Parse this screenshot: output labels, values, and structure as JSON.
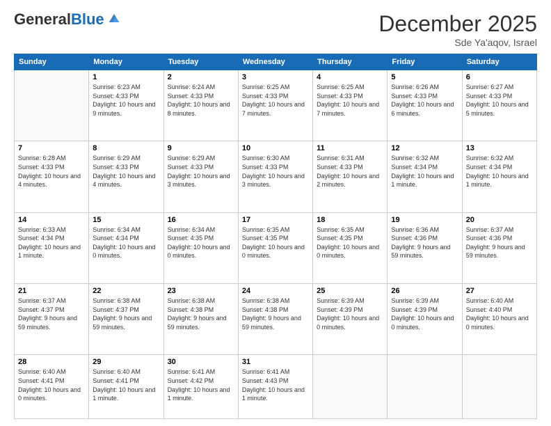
{
  "header": {
    "logo_general": "General",
    "logo_blue": "Blue",
    "month_title": "December 2025",
    "location": "Sde Ya'aqov, Israel"
  },
  "weekdays": [
    "Sunday",
    "Monday",
    "Tuesday",
    "Wednesday",
    "Thursday",
    "Friday",
    "Saturday"
  ],
  "weeks": [
    [
      {
        "day": "",
        "sunrise": "",
        "sunset": "",
        "daylight": ""
      },
      {
        "day": "1",
        "sunrise": "Sunrise: 6:23 AM",
        "sunset": "Sunset: 4:33 PM",
        "daylight": "Daylight: 10 hours and 9 minutes."
      },
      {
        "day": "2",
        "sunrise": "Sunrise: 6:24 AM",
        "sunset": "Sunset: 4:33 PM",
        "daylight": "Daylight: 10 hours and 8 minutes."
      },
      {
        "day": "3",
        "sunrise": "Sunrise: 6:25 AM",
        "sunset": "Sunset: 4:33 PM",
        "daylight": "Daylight: 10 hours and 7 minutes."
      },
      {
        "day": "4",
        "sunrise": "Sunrise: 6:25 AM",
        "sunset": "Sunset: 4:33 PM",
        "daylight": "Daylight: 10 hours and 7 minutes."
      },
      {
        "day": "5",
        "sunrise": "Sunrise: 6:26 AM",
        "sunset": "Sunset: 4:33 PM",
        "daylight": "Daylight: 10 hours and 6 minutes."
      },
      {
        "day": "6",
        "sunrise": "Sunrise: 6:27 AM",
        "sunset": "Sunset: 4:33 PM",
        "daylight": "Daylight: 10 hours and 5 minutes."
      }
    ],
    [
      {
        "day": "7",
        "sunrise": "Sunrise: 6:28 AM",
        "sunset": "Sunset: 4:33 PM",
        "daylight": "Daylight: 10 hours and 4 minutes."
      },
      {
        "day": "8",
        "sunrise": "Sunrise: 6:29 AM",
        "sunset": "Sunset: 4:33 PM",
        "daylight": "Daylight: 10 hours and 4 minutes."
      },
      {
        "day": "9",
        "sunrise": "Sunrise: 6:29 AM",
        "sunset": "Sunset: 4:33 PM",
        "daylight": "Daylight: 10 hours and 3 minutes."
      },
      {
        "day": "10",
        "sunrise": "Sunrise: 6:30 AM",
        "sunset": "Sunset: 4:33 PM",
        "daylight": "Daylight: 10 hours and 3 minutes."
      },
      {
        "day": "11",
        "sunrise": "Sunrise: 6:31 AM",
        "sunset": "Sunset: 4:33 PM",
        "daylight": "Daylight: 10 hours and 2 minutes."
      },
      {
        "day": "12",
        "sunrise": "Sunrise: 6:32 AM",
        "sunset": "Sunset: 4:34 PM",
        "daylight": "Daylight: 10 hours and 1 minute."
      },
      {
        "day": "13",
        "sunrise": "Sunrise: 6:32 AM",
        "sunset": "Sunset: 4:34 PM",
        "daylight": "Daylight: 10 hours and 1 minute."
      }
    ],
    [
      {
        "day": "14",
        "sunrise": "Sunrise: 6:33 AM",
        "sunset": "Sunset: 4:34 PM",
        "daylight": "Daylight: 10 hours and 1 minute."
      },
      {
        "day": "15",
        "sunrise": "Sunrise: 6:34 AM",
        "sunset": "Sunset: 4:34 PM",
        "daylight": "Daylight: 10 hours and 0 minutes."
      },
      {
        "day": "16",
        "sunrise": "Sunrise: 6:34 AM",
        "sunset": "Sunset: 4:35 PM",
        "daylight": "Daylight: 10 hours and 0 minutes."
      },
      {
        "day": "17",
        "sunrise": "Sunrise: 6:35 AM",
        "sunset": "Sunset: 4:35 PM",
        "daylight": "Daylight: 10 hours and 0 minutes."
      },
      {
        "day": "18",
        "sunrise": "Sunrise: 6:35 AM",
        "sunset": "Sunset: 4:35 PM",
        "daylight": "Daylight: 10 hours and 0 minutes."
      },
      {
        "day": "19",
        "sunrise": "Sunrise: 6:36 AM",
        "sunset": "Sunset: 4:36 PM",
        "daylight": "Daylight: 9 hours and 59 minutes."
      },
      {
        "day": "20",
        "sunrise": "Sunrise: 6:37 AM",
        "sunset": "Sunset: 4:36 PM",
        "daylight": "Daylight: 9 hours and 59 minutes."
      }
    ],
    [
      {
        "day": "21",
        "sunrise": "Sunrise: 6:37 AM",
        "sunset": "Sunset: 4:37 PM",
        "daylight": "Daylight: 9 hours and 59 minutes."
      },
      {
        "day": "22",
        "sunrise": "Sunrise: 6:38 AM",
        "sunset": "Sunset: 4:37 PM",
        "daylight": "Daylight: 9 hours and 59 minutes."
      },
      {
        "day": "23",
        "sunrise": "Sunrise: 6:38 AM",
        "sunset": "Sunset: 4:38 PM",
        "daylight": "Daylight: 9 hours and 59 minutes."
      },
      {
        "day": "24",
        "sunrise": "Sunrise: 6:38 AM",
        "sunset": "Sunset: 4:38 PM",
        "daylight": "Daylight: 9 hours and 59 minutes."
      },
      {
        "day": "25",
        "sunrise": "Sunrise: 6:39 AM",
        "sunset": "Sunset: 4:39 PM",
        "daylight": "Daylight: 10 hours and 0 minutes."
      },
      {
        "day": "26",
        "sunrise": "Sunrise: 6:39 AM",
        "sunset": "Sunset: 4:39 PM",
        "daylight": "Daylight: 10 hours and 0 minutes."
      },
      {
        "day": "27",
        "sunrise": "Sunrise: 6:40 AM",
        "sunset": "Sunset: 4:40 PM",
        "daylight": "Daylight: 10 hours and 0 minutes."
      }
    ],
    [
      {
        "day": "28",
        "sunrise": "Sunrise: 6:40 AM",
        "sunset": "Sunset: 4:41 PM",
        "daylight": "Daylight: 10 hours and 0 minutes."
      },
      {
        "day": "29",
        "sunrise": "Sunrise: 6:40 AM",
        "sunset": "Sunset: 4:41 PM",
        "daylight": "Daylight: 10 hours and 1 minute."
      },
      {
        "day": "30",
        "sunrise": "Sunrise: 6:41 AM",
        "sunset": "Sunset: 4:42 PM",
        "daylight": "Daylight: 10 hours and 1 minute."
      },
      {
        "day": "31",
        "sunrise": "Sunrise: 6:41 AM",
        "sunset": "Sunset: 4:43 PM",
        "daylight": "Daylight: 10 hours and 1 minute."
      },
      {
        "day": "",
        "sunrise": "",
        "sunset": "",
        "daylight": ""
      },
      {
        "day": "",
        "sunrise": "",
        "sunset": "",
        "daylight": ""
      },
      {
        "day": "",
        "sunrise": "",
        "sunset": "",
        "daylight": ""
      }
    ]
  ]
}
